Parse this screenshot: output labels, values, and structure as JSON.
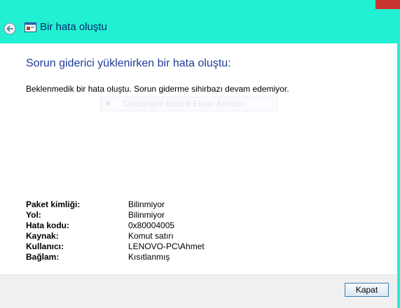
{
  "window": {
    "title": "Bir hata oluştu"
  },
  "content": {
    "heading": "Sorun giderici yüklenirken bir hata oluştu:",
    "message": "Beklenmedik bir hata oluştu. Sorun giderme sihirbazı devam edemiyor.",
    "ghost_overlay": "Dikdörtgen Biçimli Ekran Alıntısı"
  },
  "details": [
    {
      "label": "Paket kimliği:",
      "value": "Bilinmiyor"
    },
    {
      "label": "Yol:",
      "value": "Bilinmiyor"
    },
    {
      "label": "Hata kodu:",
      "value": "0x80004005"
    },
    {
      "label": "Kaynak:",
      "value": "Komut satırı"
    },
    {
      "label": "Kullanıcı:",
      "value": "LENOVO-PC\\Ahmet"
    },
    {
      "label": "Bağlam:",
      "value": "Kısıtlanmış"
    }
  ],
  "footer": {
    "close_label": "Kapat"
  },
  "colors": {
    "chrome": "#22f0d4",
    "close_button": "#c7372f",
    "heading": "#1f3c9a"
  },
  "icons": {
    "back": "back-arrow-icon",
    "app": "troubleshooter-app-icon"
  }
}
